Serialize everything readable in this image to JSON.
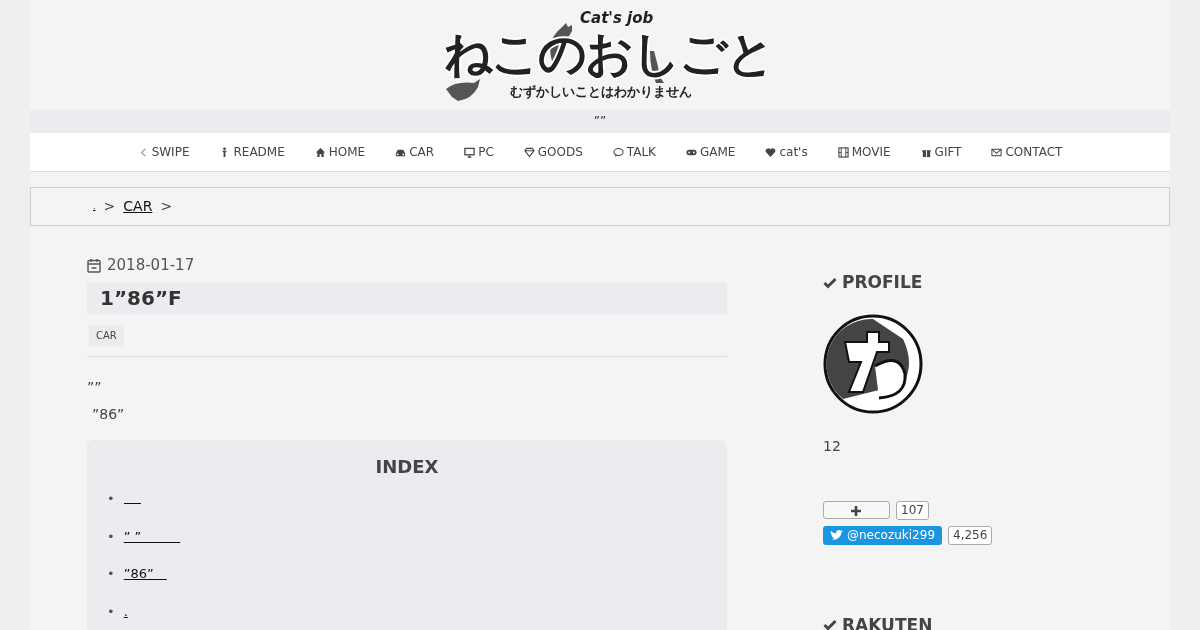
{
  "header": {
    "logo_title": "ねこのおしごと",
    "logo_subtitle": "Cat's job",
    "logo_tagline": "むずかしいことはわかりません",
    "description": "””"
  },
  "nav": [
    {
      "label": "SWIPE"
    },
    {
      "label": "README"
    },
    {
      "label": "HOME"
    },
    {
      "label": "CAR"
    },
    {
      "label": "PC"
    },
    {
      "label": "GOODS"
    },
    {
      "label": "TALK"
    },
    {
      "label": "GAME"
    },
    {
      "label": "cat's"
    },
    {
      "label": "MOVIE"
    },
    {
      "label": "GIFT"
    },
    {
      "label": "CONTACT"
    }
  ],
  "breadcrumb": [
    {
      "label": ".",
      "kind": "link"
    },
    {
      "label": ">",
      "kind": "sep"
    },
    {
      "label": "CAR",
      "kind": "link"
    },
    {
      "label": ">",
      "kind": "sep"
    }
  ],
  "article": {
    "date": "2018-01-17",
    "title": "1”86”F",
    "category": "CAR",
    "paragraphs": [
      "””",
      "”86”"
    ],
    "index": {
      "title": "INDEX",
      "items": [
        {
          "marker": "•",
          "kind": "blank"
        },
        {
          "marker": "•",
          "kind": "link",
          "text": "” ”　　　"
        },
        {
          "marker": "•",
          "kind": "link",
          "text": "”86”　"
        },
        {
          "marker": "•",
          "kind": "link",
          "text": "."
        }
      ]
    }
  },
  "sidebar": {
    "profile": {
      "title": "PROFILE",
      "text": "12",
      "bookmark_count": "107",
      "twitter_handle": "@necozuki299",
      "twitter_count": "4,256"
    },
    "next_title": "RAKUTEN"
  }
}
